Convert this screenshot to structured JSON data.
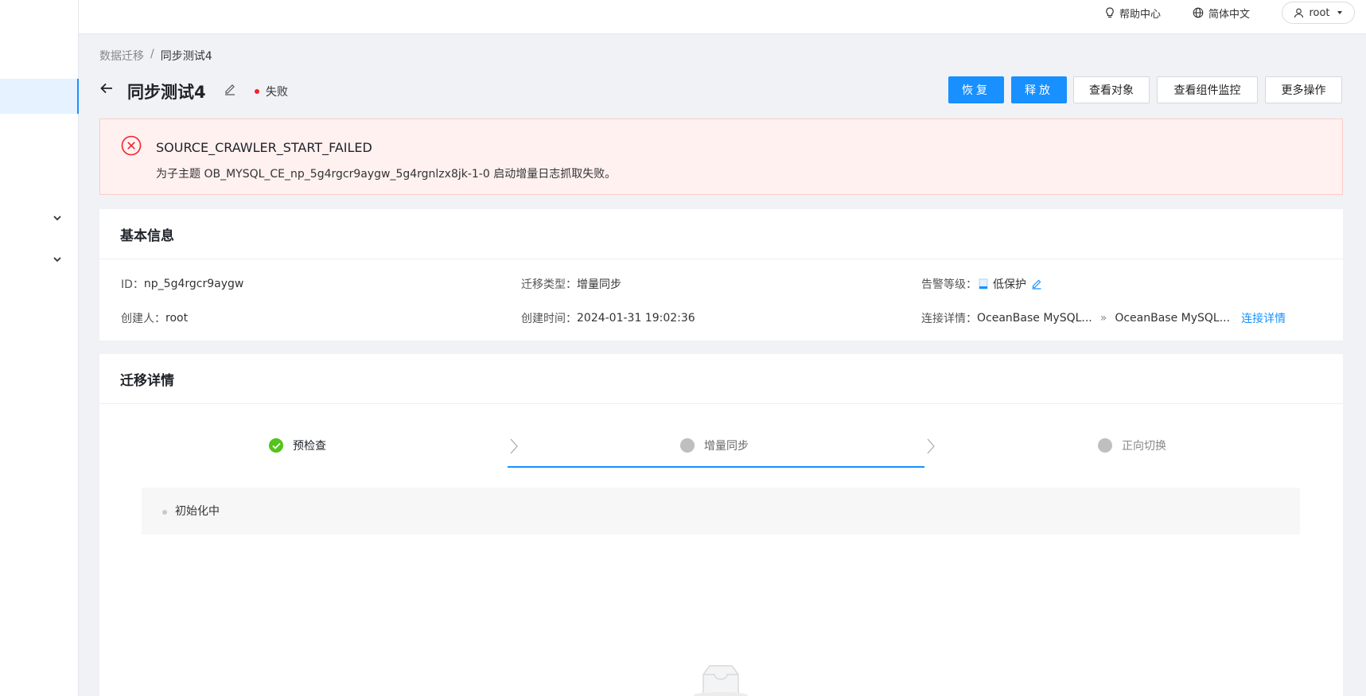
{
  "topbar": {
    "help": "帮助中心",
    "language": "简体中文",
    "user": "root"
  },
  "breadcrumb": {
    "parent": "数据迁移",
    "separator": "/",
    "current": "同步测试4"
  },
  "header": {
    "title": "同步测试4",
    "status": "失败",
    "status_color": "#f5222d",
    "buttons": {
      "restore": "恢复",
      "release": "释放",
      "view_objects": "查看对象",
      "view_monitor": "查看组件监控",
      "more": "更多操作"
    }
  },
  "alert": {
    "code": "SOURCE_CRAWLER_START_FAILED",
    "message": "为子主题 OB_MYSQL_CE_np_5g4rgcr9aygw_5g4rgnlzx8jk-1-0 启动增量日志抓取失败。"
  },
  "basic_info": {
    "title": "基本信息",
    "id_label": "ID：",
    "id_value": "np_5g4rgcr9aygw",
    "type_label": "迁移类型：",
    "type_value": "增量同步",
    "alarm_label": "告警等级：",
    "alarm_value": "低保护",
    "creator_label": "创建人：",
    "creator_value": "root",
    "created_label": "创建时间：",
    "created_value": "2024-01-31 19:02:36",
    "conn_label": "连接详情：",
    "conn_source": "OceanBase MySQL...",
    "conn_arrow": "»",
    "conn_target": "OceanBase MySQL...",
    "conn_link": "连接详情"
  },
  "migration": {
    "title": "迁移详情",
    "steps": [
      {
        "label": "预检查",
        "state": "done"
      },
      {
        "label": "增量同步",
        "state": "active"
      },
      {
        "label": "正向切换",
        "state": "pending"
      }
    ],
    "progress_text": "初始化中"
  },
  "colors": {
    "primary": "#1890ff",
    "success": "#52c41a",
    "error": "#f5222d"
  }
}
